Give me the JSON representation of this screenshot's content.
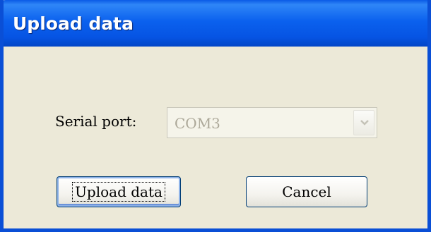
{
  "window": {
    "title": "Upload data"
  },
  "form": {
    "serial_port_label": "Serial port:",
    "serial_port_value": "COM3",
    "serial_port_enabled": false
  },
  "buttons": {
    "upload_label": "Upload data",
    "cancel_label": "Cancel"
  },
  "icons": {
    "dropdown": "chevron-down-icon"
  },
  "colors": {
    "titlebar": "#0a5be6",
    "window_bg": "#ece9d8",
    "disabled_text": "#aca899",
    "button_border": "#003c74"
  }
}
